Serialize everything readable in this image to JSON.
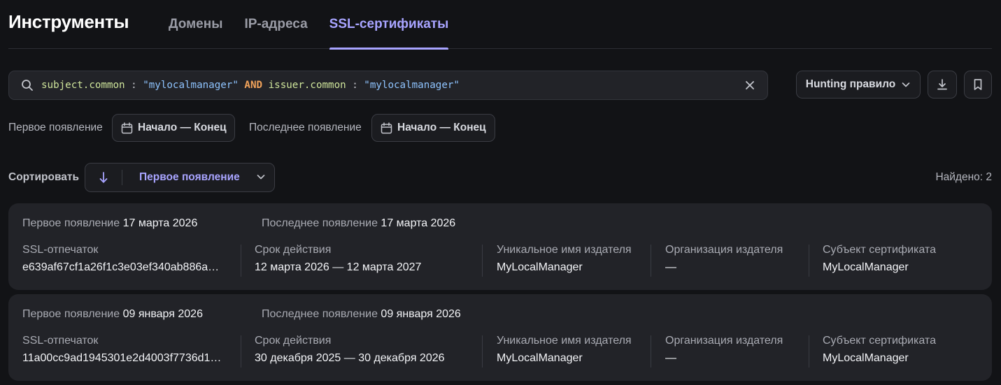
{
  "header": {
    "title": "Инструменты",
    "tabs": [
      {
        "label": "Домены",
        "active": false
      },
      {
        "label": "IP-адреса",
        "active": false
      },
      {
        "label": "SSL-сертификаты",
        "active": true
      }
    ]
  },
  "search": {
    "field1": "subject.common",
    "op1": " : ",
    "value1": "\"mylocalmanager\"",
    "keyword": " AND ",
    "field2": "issuer.common",
    "op2": " : ",
    "value2": "\"mylocalmanager\""
  },
  "toolbar": {
    "hunting_label": "Hunting правило"
  },
  "filters": {
    "first_label": "Первое появление",
    "first_range": "Начало — Конец",
    "last_label": "Последнее появление",
    "last_range": "Начало — Конец"
  },
  "sort": {
    "label": "Сортировать",
    "direction_icon": "↓",
    "selected": "Первое появление"
  },
  "found": "Найдено: 2",
  "results": {
    "labels": {
      "first_seen": "Первое появление",
      "last_seen": "Последнее появление",
      "fingerprint": "SSL-отпечаток",
      "validity": "Срок действия",
      "issuer_cn": "Уникальное имя издателя",
      "issuer_org": "Организация издателя",
      "subject": "Субъект сертификата"
    },
    "items": [
      {
        "first_seen": "17 марта 2026",
        "last_seen": "17 марта 2026",
        "fingerprint": "e639af67cf1a26f1c3e03ef340ab886a…",
        "validity": "12 марта 2026 — 12 марта 2027",
        "issuer_cn": "MyLocalManager",
        "issuer_org": "—",
        "subject": "MyLocalManager"
      },
      {
        "first_seen": "09 января 2026",
        "last_seen": "09 января 2026",
        "fingerprint": "11a00cc9ad1945301e2d4003f7736d1…",
        "validity": "30 декабря 2025 — 30 декабря 2026",
        "issuer_cn": "MyLocalManager",
        "issuer_org": "—",
        "subject": "MyLocalManager"
      }
    ]
  },
  "colors": {
    "background": "#121316",
    "card": "#222328",
    "accent": "#a8a4ff",
    "query_field": "#cfe59b",
    "query_value": "#8fc4ff",
    "query_keyword": "#f2a35b"
  },
  "icons": [
    "search-icon",
    "close-icon",
    "chevron-down-icon",
    "download-icon",
    "bookmark-icon",
    "calendar-icon",
    "arrow-down-icon"
  ]
}
